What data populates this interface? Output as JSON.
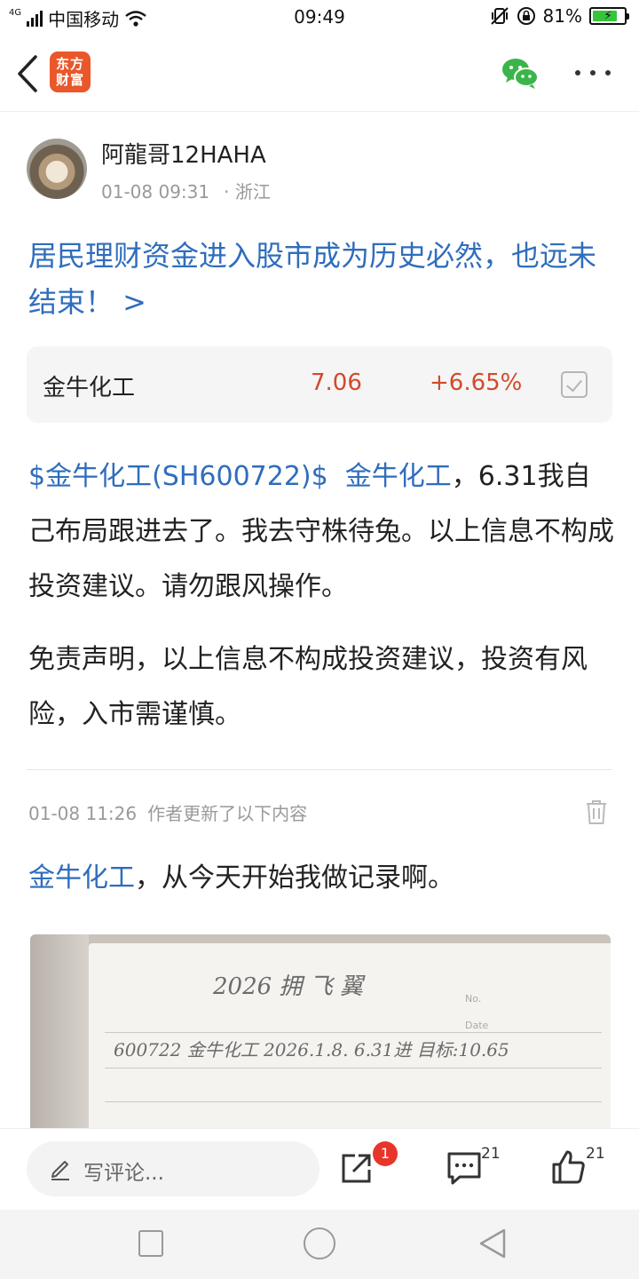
{
  "status_bar": {
    "network": "4G",
    "carrier": "中国移动",
    "time": "09:49",
    "battery": "81%",
    "battery_level": 0.81
  },
  "nav": {
    "logo_line1": "东方",
    "logo_line2": "财富",
    "icons": [
      "back-arrow-icon",
      "wechat-icon",
      "more-icon"
    ]
  },
  "author": {
    "name": "阿龍哥12HAHA",
    "time": "01-08 09:31",
    "location": "· 浙江"
  },
  "post": {
    "title": "居民理财资金进入股市成为历史必然，也远未结束！ >",
    "body_link1": "$金牛化工(SH600722)$",
    "body_link2": "金牛化工",
    "body_text": "，6.31我自己布局跟进去了。我去守株待兔。以上信息不构成投资建议。请勿跟风操作。",
    "disclaimer": "免责声明，以上信息不构成投资建议，投资有风险，入市需谨慎。"
  },
  "stock": {
    "name": "金牛化工",
    "price": "7.06",
    "change": "+6.65%",
    "color": "#d24a2a"
  },
  "update": {
    "time": "01-08 11:26",
    "label": "作者更新了以下内容",
    "link": "金牛化工",
    "text": "，从今天开始我做记录啊。"
  },
  "note_image": {
    "line1": "2026  拥 飞  翼",
    "line2": "600722  金牛化工  2026.1.8.  6.31进  目标:10.65",
    "no_label": "No.",
    "date_label": "Date"
  },
  "actions": {
    "comment_placeholder": "写评论...",
    "share_badge": "1",
    "comment_count": "21",
    "like_count": "21"
  },
  "colors": {
    "link": "#2f6dbd",
    "up": "#d24a2a",
    "brand": "#e9572b"
  }
}
